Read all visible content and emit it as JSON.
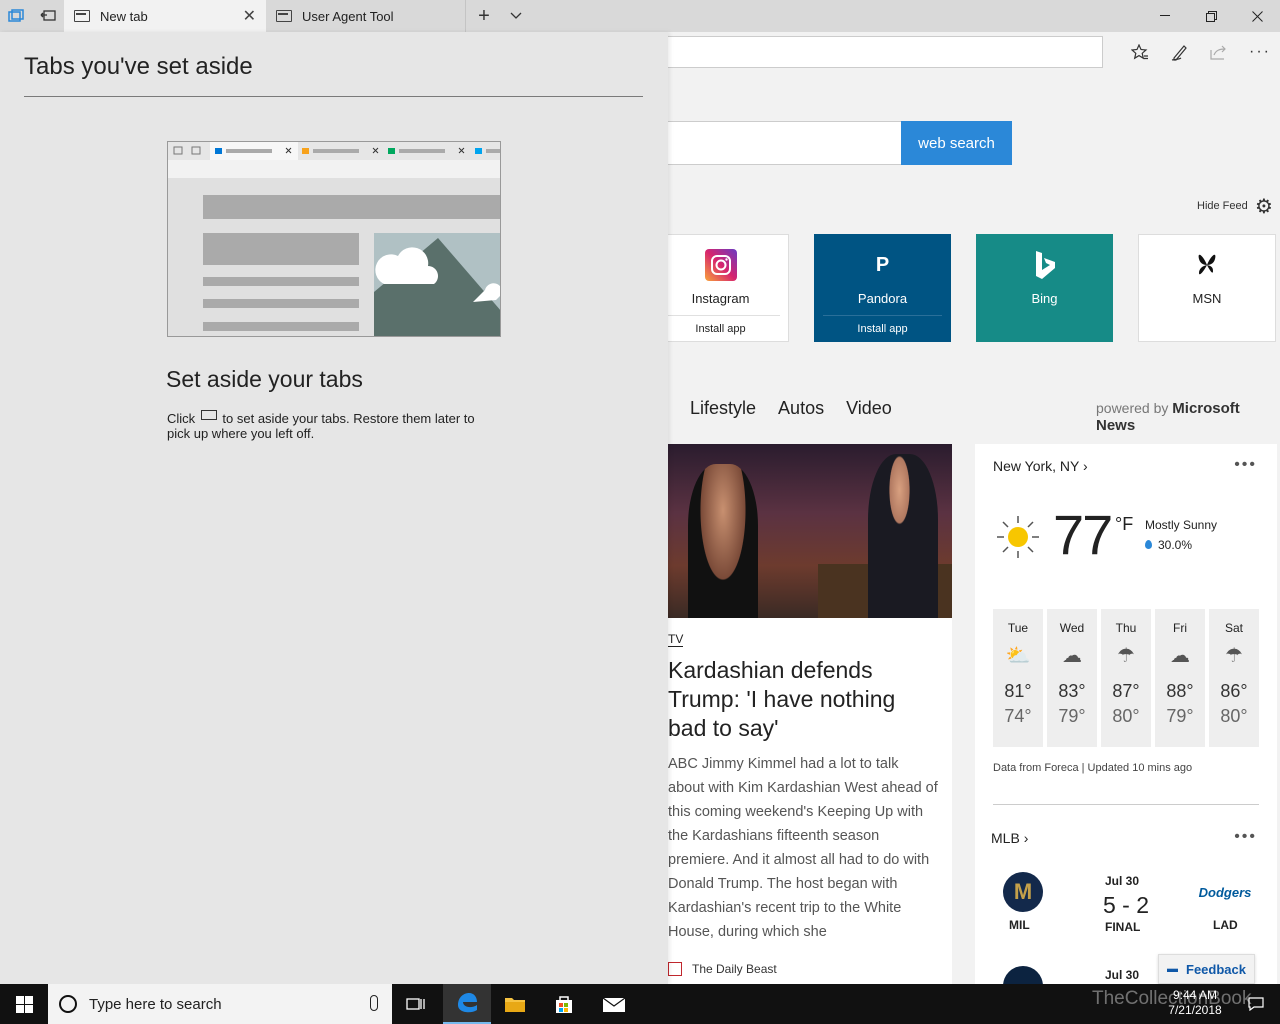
{
  "tabs": [
    {
      "label": "New tab"
    },
    {
      "label": "User Agent Tool"
    }
  ],
  "search": {
    "button_label": "web search"
  },
  "feed": {
    "hide_label": "Hide Feed"
  },
  "tiles": [
    {
      "name": "Instagram",
      "sub": "Install app",
      "icon": "instagram-icon"
    },
    {
      "name": "Pandora",
      "sub": "Install app",
      "icon": "pandora-icon",
      "logo": "P"
    },
    {
      "name": "Bing",
      "icon": "bing-icon"
    },
    {
      "name": "MSN",
      "icon": "msn-butterfly-icon"
    }
  ],
  "news_nav": [
    "Lifestyle",
    "Autos",
    "Video"
  ],
  "powered": {
    "prefix": "powered by",
    "brand": "Microsoft News"
  },
  "article": {
    "category": "TV",
    "title": "Kardashian defends Trump: 'I have nothing bad to say'",
    "body": "ABC Jimmy Kimmel had a lot to talk about with Kim Kardashian West ahead of this coming weekend's Keeping Up with the Kardashians fifteenth season premiere. And it almost all had to do with Donald Trump. The host began with Kardashian's recent trip to the White House, during which she",
    "source": "The Daily Beast"
  },
  "weather": {
    "location": "New York, NY",
    "temp": "77",
    "unit": "°F",
    "condition": "Mostly Sunny",
    "precip": "30.0%",
    "forecast": [
      {
        "day": "Tue",
        "hi": "81°",
        "lo": "74°",
        "icon": "partly-sunny-icon"
      },
      {
        "day": "Wed",
        "hi": "83°",
        "lo": "79°",
        "icon": "thunderstorm-icon"
      },
      {
        "day": "Thu",
        "hi": "87°",
        "lo": "80°",
        "icon": "rain-icon"
      },
      {
        "day": "Fri",
        "hi": "88°",
        "lo": "79°",
        "icon": "thunderstorm-icon"
      },
      {
        "day": "Sat",
        "hi": "86°",
        "lo": "80°",
        "icon": "rain-icon"
      }
    ],
    "source": "Data from Foreca | Updated 10 mins ago"
  },
  "mlb": {
    "title": "MLB",
    "game1": {
      "date": "Jul 30",
      "home": "MIL",
      "away": "LAD",
      "score": "5 - 2",
      "status": "FINAL"
    },
    "game2": {
      "date": "Jul 30"
    }
  },
  "feedback": {
    "label": "Feedback"
  },
  "panel": {
    "title": "Tabs you've set aside",
    "heading": "Set aside your tabs",
    "desc_before": "Click",
    "desc_after": "to set aside your tabs. Restore them later to pick up where you left off."
  },
  "taskbar": {
    "search_placeholder": "Type here to search",
    "time": "9:44 AM",
    "date": "7/21/2018",
    "watermark": "TheCollectionBook"
  },
  "colors": {
    "accent": "#2b88d8",
    "pandora": "#005483",
    "bing": "#168b87",
    "taskbar": "#111111"
  }
}
